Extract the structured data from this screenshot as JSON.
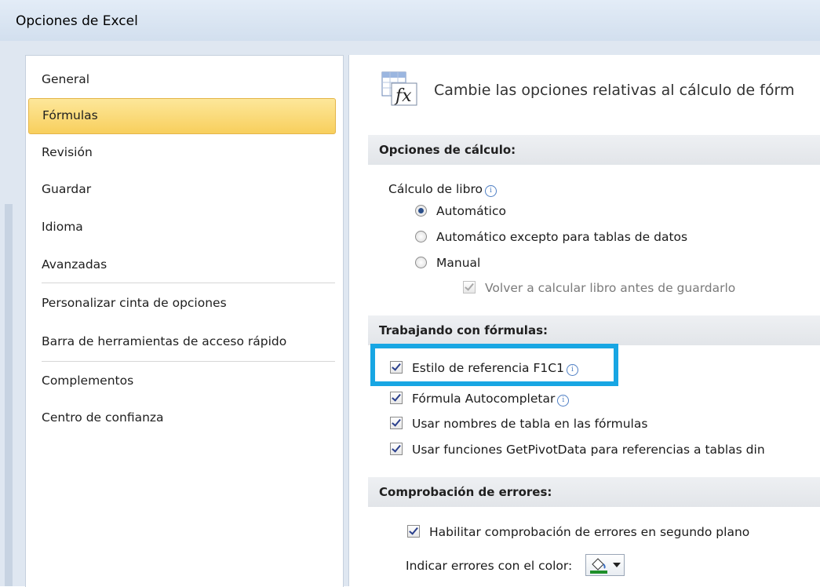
{
  "window": {
    "title": "Opciones de Excel"
  },
  "sidebar": {
    "items": [
      {
        "label": "General"
      },
      {
        "label": "Fórmulas"
      },
      {
        "label": "Revisión"
      },
      {
        "label": "Guardar"
      },
      {
        "label": "Idioma"
      },
      {
        "label": "Avanzadas"
      },
      {
        "label": "Personalizar cinta de opciones"
      },
      {
        "label": "Barra de herramientas de acceso rápido"
      },
      {
        "label": "Complementos"
      },
      {
        "label": "Centro de confianza"
      }
    ],
    "selected": "Fórmulas"
  },
  "main": {
    "header_text": "Cambie las opciones relativas al cálculo de fórm",
    "header_icon": "formula-fx-icon",
    "calc_section": {
      "title": "Opciones de cálculo:",
      "workbook_label": "Cálculo de libro",
      "options": [
        {
          "label": "Automático",
          "selected": true
        },
        {
          "label": "Automático excepto para tablas de datos",
          "selected": false
        },
        {
          "label": "Manual",
          "selected": false
        }
      ],
      "recalc_before_save": {
        "label": "Volver a calcular libro antes de guardarlo",
        "checked": true,
        "disabled": true
      }
    },
    "formulas_section": {
      "title": "Trabajando con fórmulas:",
      "items": [
        {
          "label": "Estilo de referencia F1C1",
          "checked": true
        },
        {
          "label": "Fórmula Autocompletar",
          "checked": true
        },
        {
          "label": "Usar nombres de tabla en las fórmulas",
          "checked": true
        },
        {
          "label": "Usar funciones GetPivotData para referencias a tablas din",
          "checked": true
        }
      ]
    },
    "errors_section": {
      "title": "Comprobación de errores:",
      "enable_background": {
        "label": "Habilitar comprobación de errores en segundo plano",
        "checked": true
      },
      "color_label": "Indicar errores con el color:",
      "color_value": "#1f8f2a"
    }
  },
  "colors": {
    "highlight": "#18a6e3",
    "selected_bg": "#f8cf5d"
  }
}
